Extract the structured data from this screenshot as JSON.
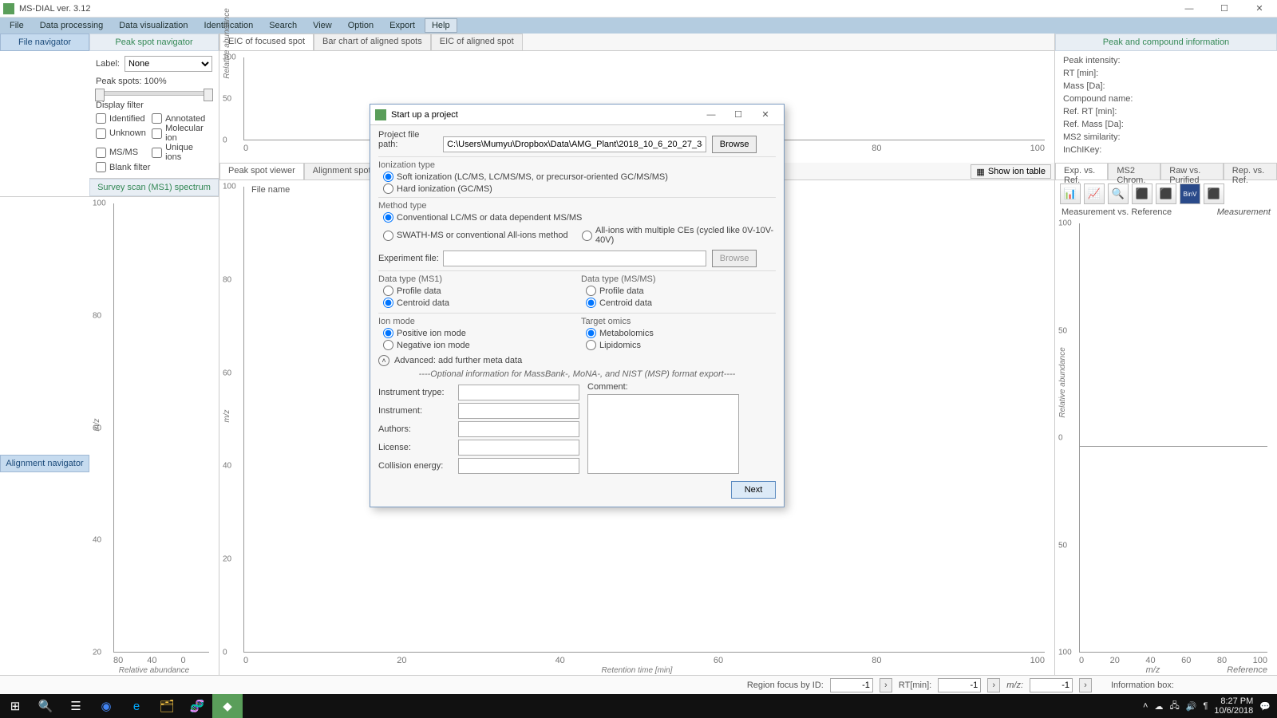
{
  "app": {
    "title": "MS-DIAL ver. 3.12"
  },
  "win_buttons": {
    "min": "—",
    "max": "☐",
    "close": "✕"
  },
  "menu": [
    "File",
    "Data processing",
    "Data visualization",
    "Identification",
    "Search",
    "View",
    "Option",
    "Export",
    "Help"
  ],
  "menu_active": "Help",
  "left": {
    "file_nav": "File navigator",
    "peak_nav": "Peak spot navigator",
    "label_label": "Label:",
    "label_value": "None",
    "spots_label": "Peak spots: 100%",
    "display_filter": "Display filter",
    "filters": [
      "Identified",
      "Annotated",
      "Unknown",
      "Molecular ion",
      "MS/MS",
      "Unique ions",
      "Blank filter"
    ],
    "survey_tab": "Survey scan (MS1) spectrum",
    "align_nav": "Alignment navigator",
    "survey_y_ticks": [
      "100",
      "80",
      "60",
      "40",
      "20"
    ],
    "survey_x_ticks": [
      "80",
      "40",
      "0"
    ],
    "survey_ylabel": "m/z",
    "survey_xlabel": "Relative abundance"
  },
  "mid": {
    "top_tabs": [
      "EIC of focused spot",
      "Bar chart of aligned spots",
      "EIC of aligned spot"
    ],
    "top_active": "EIC of focused spot",
    "top_y_ticks": [
      "100",
      "50",
      "0"
    ],
    "top_ylabel": "Relative abundance",
    "spot_tabs": [
      "Peak spot viewer",
      "Alignment spot viewer"
    ],
    "spot_active": "Peak spot viewer",
    "file_name_label": "File name",
    "show_ion": "Show ion table",
    "bot_y_ticks": [
      "100",
      "80",
      "60",
      "40",
      "20",
      "0"
    ],
    "bot_x_ticks": [
      "0",
      "20",
      "40",
      "60",
      "80",
      "100"
    ],
    "bot_ylabel": "m/z",
    "bot_xlabel": "Retention time [min]"
  },
  "right": {
    "header": "Peak and compound information",
    "info": {
      "peak_intensity": "Peak intensity:",
      "rt_min": "RT [min]:",
      "mass_da": "Mass [Da]:",
      "compound_name": "Compound name:",
      "ref_rt": "Ref. RT [min]:",
      "ref_mass": "Ref. Mass [Da]:",
      "ms2_sim": "MS2 similarity:",
      "inchikey": "InChIKey:"
    },
    "tabs": [
      "Exp. vs. Ref.",
      "MS2 Chrom.",
      "Raw vs. Purified",
      "Rep. vs. Ref."
    ],
    "tabs_active": "Exp. vs. Ref.",
    "chart_title_left": "Measurement vs. Reference",
    "chart_title_right": "Measurement",
    "y_ticks": [
      "100",
      "50",
      "0",
      "50",
      "100"
    ],
    "x_ticks": [
      "0",
      "20",
      "40",
      "60",
      "80",
      "100"
    ],
    "ylabel": "Relative abundance",
    "xlabel_left": "m/z",
    "xlabel_right": "Reference"
  },
  "idbar": {
    "region_label": "Region focus by ID:",
    "region_val": "-1",
    "rt_label": "RT[min]:",
    "rt_val": "-1",
    "mz_label": "m/z:",
    "mz_val": "-1",
    "info_label": "Information box:"
  },
  "taskbar": {
    "time": "8:27 PM",
    "date": "10/6/2018"
  },
  "modal": {
    "title": "Start up a project",
    "proj_path_label": "Project file path:",
    "proj_path_value": "C:\\Users\\Mumyu\\Dropbox\\Data\\AMG_Plant\\2018_10_6_20_27_34.mtd",
    "browse": "Browse",
    "ionization_label": "Ionization type",
    "ionization_opts": [
      "Soft ionization (LC/MS, LC/MS/MS, or precursor-oriented GC/MS/MS)",
      "Hard ionization (GC/MS)"
    ],
    "method_label": "Method type",
    "method_opts": [
      "Conventional LC/MS or data dependent MS/MS",
      "SWATH-MS or conventional All-ions method",
      "All-ions with multiple CEs (cycled like 0V-10V-40V)"
    ],
    "exp_file_label": "Experiment file:",
    "ms1_label": "Data type (MS1)",
    "msms_label": "Data type (MS/MS)",
    "dtype_opts": [
      "Profile data",
      "Centroid data"
    ],
    "ion_mode_label": "Ion mode",
    "ion_mode_opts": [
      "Positive ion mode",
      "Negative ion mode"
    ],
    "omics_label": "Target omics",
    "omics_opts": [
      "Metabolomics",
      "Lipidomics"
    ],
    "advanced": "Advanced: add further meta data",
    "opt_note": "----Optional information for MassBank-, MoNA-, and NIST (MSP) format export----",
    "meta": {
      "instr_type": "Instrument trype:",
      "instrument": "Instrument:",
      "authors": "Authors:",
      "license": "License:",
      "collision": "Collision energy:",
      "comment": "Comment:"
    },
    "next": "Next"
  },
  "chart_data": [
    {
      "type": "line",
      "role": "EIC of focused spot",
      "x": [],
      "y": [],
      "ylabel": "Relative abundance",
      "ylim": [
        0,
        100
      ]
    },
    {
      "type": "scatter",
      "role": "Peak spot viewer",
      "x": [],
      "y": [],
      "xlabel": "Retention time [min]",
      "ylabel": "m/z",
      "xlim": [
        0,
        100
      ],
      "ylim": [
        0,
        100
      ]
    },
    {
      "type": "bar",
      "role": "Survey scan (MS1) spectrum",
      "x": [],
      "y": [],
      "xlabel": "Relative abundance",
      "ylabel": "m/z",
      "xlim": [
        0,
        80
      ],
      "ylim": [
        0,
        100
      ]
    },
    {
      "type": "bar",
      "role": "Measurement vs. Reference",
      "x": [],
      "y_measurement": [],
      "y_reference": [],
      "xlabel": "m/z",
      "ylabel": "Relative abundance",
      "xlim": [
        0,
        100
      ],
      "ylim": [
        -100,
        100
      ]
    }
  ]
}
